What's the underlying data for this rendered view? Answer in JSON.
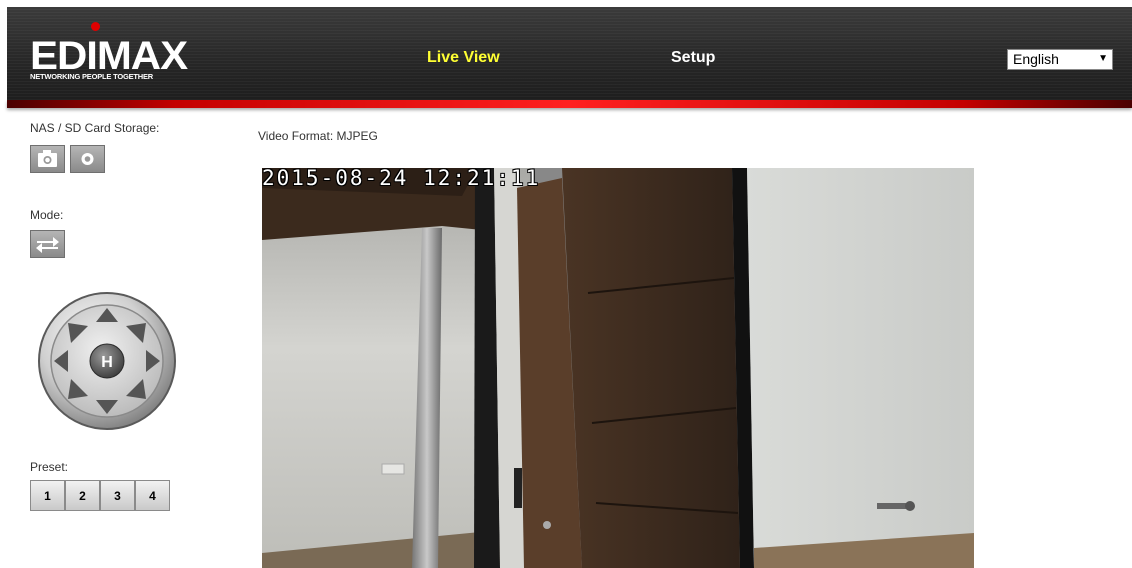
{
  "header": {
    "logo_text": "EDIMAX",
    "logo_tagline": "NETWORKING PEOPLE TOGETHER",
    "nav": {
      "live_view": "Live View",
      "setup": "Setup"
    },
    "language": {
      "selected": "English"
    }
  },
  "sidebar": {
    "storage_label": "NAS / SD Card Storage:",
    "storage_buttons": [
      "camera-snapshot-icon",
      "record-icon"
    ],
    "mode_label": "Mode:",
    "mode_button": "mode-switch-icon",
    "ptz": {
      "home_label": "H",
      "directions": [
        "up",
        "up-right",
        "right",
        "down-right",
        "down",
        "down-left",
        "left",
        "up-left"
      ]
    },
    "preset_label": "Preset:",
    "presets": [
      "1",
      "2",
      "3",
      "4"
    ]
  },
  "main": {
    "video_format": "Video Format: MJPEG",
    "timestamp": "2015-08-24 12:21:11"
  },
  "colors": {
    "active_nav": "#ffff33",
    "header_bg": "#2a2a2a",
    "accent_red": "#e00000"
  }
}
